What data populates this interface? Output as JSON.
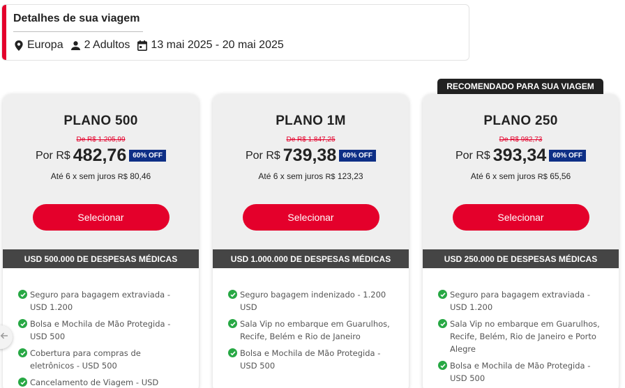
{
  "trip": {
    "title": "Detalhes de sua viagem",
    "destination": "Europa",
    "travelers": "2 Adultos",
    "dates": "13 mai 2025 - 20 mai 2025"
  },
  "recommended_badge": "RECOMENDADO PARA SUA VIAGEM",
  "plans": [
    {
      "name": "PLANO 500",
      "old_price": "De R$ 1.205,99",
      "por_label": "Por R$",
      "price": "482,76",
      "discount": "60% OFF",
      "installment_text": "Até 6 x sem juros ",
      "installment_currency": "R$",
      "installment_value": " 80,46",
      "select_label": "Selecionar",
      "coverage": "USD 500.000 DE DESPESAS MÉDICAS",
      "features": [
        "Seguro para bagagem extraviada - USD 1.200",
        "Bolsa e Mochila de Mão Protegida - USD 500",
        "Cobertura para compras de eletrônicos - USD 500",
        "Cancelamento de Viagem - USD"
      ]
    },
    {
      "name": "PLANO 1M",
      "old_price": "De R$ 1.847,25",
      "por_label": "Por R$",
      "price": "739,38",
      "discount": "60% OFF",
      "installment_text": "Até 6 x sem juros ",
      "installment_currency": "R$",
      "installment_value": " 123,23",
      "select_label": "Selecionar",
      "coverage": "USD 1.000.000 DE DESPESAS MÉDICAS",
      "features": [
        "Seguro bagagem indenizado - 1.200 USD",
        "Sala Vip no embarque em Guarulhos, Recife, Belém e Rio de Janeiro",
        "Bolsa e Mochila de Mão Protegida - USD 500"
      ]
    },
    {
      "name": "PLANO 250",
      "old_price": "De R$ 982,73",
      "por_label": "Por R$",
      "price": "393,34",
      "discount": "60% OFF",
      "installment_text": "Até 6 x sem juros ",
      "installment_currency": "R$",
      "installment_value": " 65,56",
      "select_label": "Selecionar",
      "coverage": "USD 250.000 DE DESPESAS MÉDICAS",
      "features": [
        "Seguro para bagagem extraviada - USD 1.200",
        "Sala Vip no embarque em Guarulhos, Recife, Belém, Rio de Janeiro e Porto Alegre",
        "Bolsa e Mochila de Mão Protegida - USD 500"
      ]
    }
  ],
  "colors": {
    "accent": "#e4002b",
    "discount_badge": "#0e2f86",
    "coverage_bar": "#454545",
    "check": "#27a844"
  },
  "icons": {
    "destination": "location-pin-icon",
    "travelers": "person-icon",
    "dates": "calendar-icon",
    "carousel_prev": "arrow-left-icon",
    "feature_check": "check-circle-icon"
  }
}
